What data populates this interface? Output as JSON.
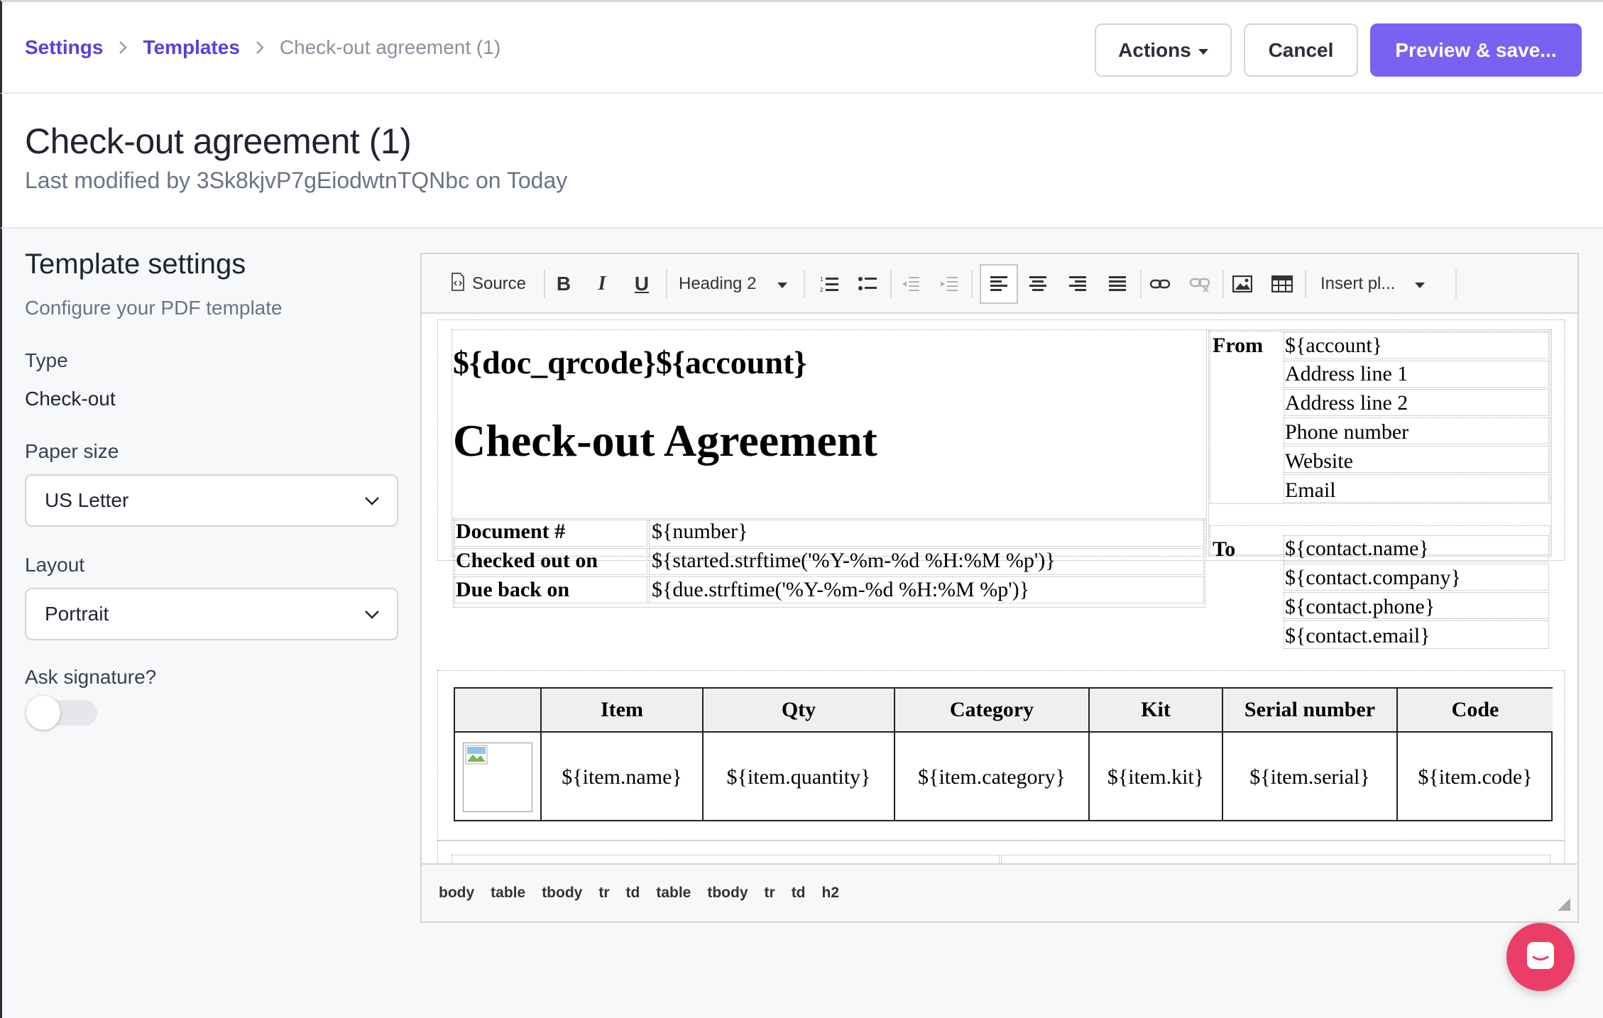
{
  "breadcrumb": {
    "items": [
      "Settings",
      "Templates"
    ],
    "current": "Check-out agreement (1)"
  },
  "actions": {
    "actions_label": "Actions",
    "cancel_label": "Cancel",
    "save_label": "Preview & save..."
  },
  "header": {
    "title": "Check-out agreement (1)",
    "subtitle": "Last modified by 3Sk8kjvP7gEiodwtnTQNbc on Today"
  },
  "settings": {
    "title": "Template settings",
    "subtitle": "Configure your PDF template",
    "type_label": "Type",
    "type_value": "Check-out",
    "paper_label": "Paper size",
    "paper_value": "US Letter",
    "layout_label": "Layout",
    "layout_value": "Portrait",
    "signature_label": "Ask signature?",
    "signature_enabled": false
  },
  "toolbar": {
    "source_label": "Source",
    "format_value": "Heading 2",
    "insert_label": "Insert pl..."
  },
  "document": {
    "header_line": "${doc_qrcode}${account}",
    "heading": "Check-out Agreement",
    "meta_rows": [
      {
        "label": "Document #",
        "value": "${number}"
      },
      {
        "label": "Checked out on",
        "value": "${started.strftime('%Y-%m-%d %H:%M %p')}"
      },
      {
        "label": "Due back on",
        "value": "${due.strftime('%Y-%m-%d %H:%M %p')}"
      }
    ],
    "from_label": "From",
    "from_lines": [
      "${account}",
      "Address line 1",
      "Address line 2",
      "Phone number",
      "Website",
      "Email"
    ],
    "to_label": "To",
    "to_lines": [
      "${contact.name}",
      "${contact.company}",
      "${contact.phone}",
      "${contact.email}"
    ],
    "items_headers": [
      "",
      "Item",
      "Qty",
      "Category",
      "Kit",
      "Serial number",
      "Code"
    ],
    "items_row": [
      "",
      "${item.name}",
      "${item.quantity}",
      "${item.category}",
      "${item.kit}",
      "${item.serial}",
      "${item.code}"
    ]
  },
  "statusbar": {
    "path": [
      "body",
      "table",
      "tbody",
      "tr",
      "td",
      "table",
      "tbody",
      "tr",
      "td",
      "h2"
    ]
  },
  "colors": {
    "accent": "#7b61f2",
    "link": "#5a3ee0",
    "chat": "#ea3e68"
  }
}
